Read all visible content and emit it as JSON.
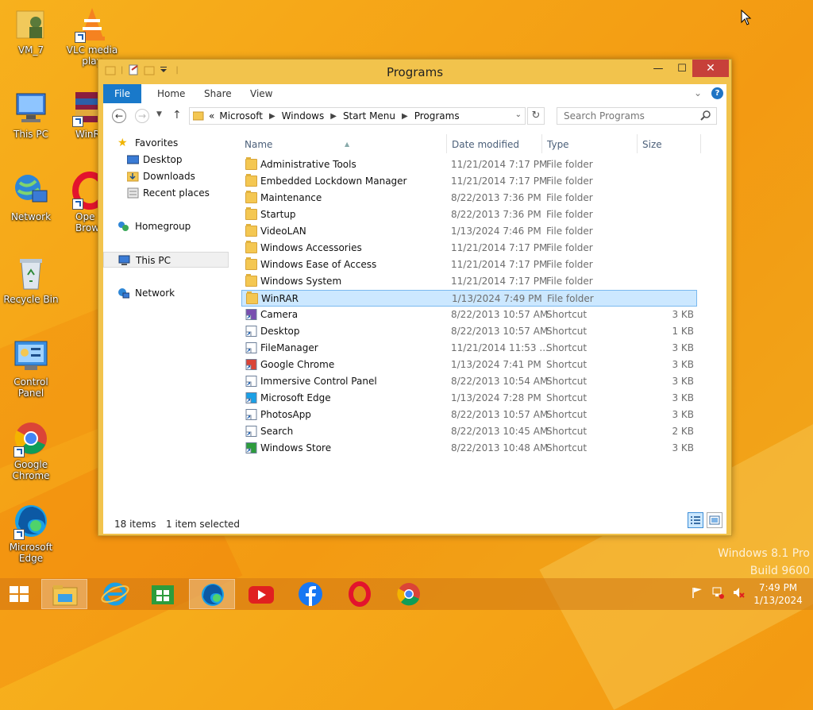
{
  "desktop": {
    "icons": [
      {
        "label": "VM_7"
      },
      {
        "label": "VLC media play"
      },
      {
        "label": "This PC"
      },
      {
        "label": "WinR"
      },
      {
        "label": "Network"
      },
      {
        "label": "Ope Brow"
      },
      {
        "label": "Recycle Bin"
      },
      {
        "label": "Control Panel"
      },
      {
        "label": "Google Chrome"
      },
      {
        "label": "Microsoft Edge"
      }
    ],
    "watermark": {
      "line1": "Windows 8.1 Pro",
      "line2": "Build 9600"
    }
  },
  "window": {
    "title": "Programs",
    "controls": {
      "minimize": "—",
      "maximize": "☐",
      "close": "✕"
    },
    "ribbon": {
      "tabs": [
        "File",
        "Home",
        "Share",
        "View"
      ],
      "help": "?"
    },
    "address": {
      "prefix": "«",
      "breadcrumbs": [
        "Microsoft",
        "Windows",
        "Start Menu",
        "Programs"
      ]
    },
    "search": {
      "placeholder": "Search Programs"
    },
    "nav_pane": {
      "favorites": "Favorites",
      "favorites_items": [
        "Desktop",
        "Downloads",
        "Recent places"
      ],
      "homegroup": "Homegroup",
      "this_pc": "This PC",
      "network": "Network"
    },
    "columns": {
      "name": "Name",
      "date": "Date modified",
      "type": "Type",
      "size": "Size"
    },
    "files": [
      {
        "name": "Administrative Tools",
        "date": "11/21/2014 7:17 PM",
        "type": "File folder",
        "size": "",
        "icon": "folder-icon"
      },
      {
        "name": "Embedded Lockdown Manager",
        "date": "11/21/2014 7:17 PM",
        "type": "File folder",
        "size": "",
        "icon": "folder-icon"
      },
      {
        "name": "Maintenance",
        "date": "8/22/2013 7:36 PM",
        "type": "File folder",
        "size": "",
        "icon": "folder-icon"
      },
      {
        "name": "Startup",
        "date": "8/22/2013 7:36 PM",
        "type": "File folder",
        "size": "",
        "icon": "folder-icon"
      },
      {
        "name": "VideoLAN",
        "date": "1/13/2024 7:46 PM",
        "type": "File folder",
        "size": "",
        "icon": "folder-icon"
      },
      {
        "name": "Windows Accessories",
        "date": "11/21/2014 7:17 PM",
        "type": "File folder",
        "size": "",
        "icon": "folder-icon"
      },
      {
        "name": "Windows Ease of Access",
        "date": "11/21/2014 7:17 PM",
        "type": "File folder",
        "size": "",
        "icon": "folder-icon"
      },
      {
        "name": "Windows System",
        "date": "11/21/2014 7:17 PM",
        "type": "File folder",
        "size": "",
        "icon": "folder-icon"
      },
      {
        "name": "WinRAR",
        "date": "1/13/2024 7:49 PM",
        "type": "File folder",
        "size": "",
        "icon": "folder-icon"
      },
      {
        "name": "Camera",
        "date": "8/22/2013 10:57 AM",
        "type": "Shortcut",
        "size": "3 KB",
        "icon": "camera-icon"
      },
      {
        "name": "Desktop",
        "date": "8/22/2013 10:57 AM",
        "type": "Shortcut",
        "size": "1 KB",
        "icon": "shortcut-icon"
      },
      {
        "name": "FileManager",
        "date": "11/21/2014 11:53 ...",
        "type": "Shortcut",
        "size": "3 KB",
        "icon": "shortcut-icon"
      },
      {
        "name": "Google Chrome",
        "date": "1/13/2024 7:41 PM",
        "type": "Shortcut",
        "size": "3 KB",
        "icon": "chrome-icon"
      },
      {
        "name": "Immersive Control Panel",
        "date": "8/22/2013 10:54 AM",
        "type": "Shortcut",
        "size": "3 KB",
        "icon": "shortcut-icon"
      },
      {
        "name": "Microsoft Edge",
        "date": "1/13/2024 7:28 PM",
        "type": "Shortcut",
        "size": "3 KB",
        "icon": "edge-icon"
      },
      {
        "name": "PhotosApp",
        "date": "8/22/2013 10:57 AM",
        "type": "Shortcut",
        "size": "3 KB",
        "icon": "shortcut-icon"
      },
      {
        "name": "Search",
        "date": "8/22/2013 10:45 AM",
        "type": "Shortcut",
        "size": "2 KB",
        "icon": "search-icon"
      },
      {
        "name": "Windows Store",
        "date": "8/22/2013 10:48 AM",
        "type": "Shortcut",
        "size": "3 KB",
        "icon": "store-icon"
      }
    ],
    "selected_name": "WinRAR",
    "status": {
      "items": "18 items",
      "selected": "1 item selected"
    }
  },
  "taskbar": {
    "apps": [
      "file-explorer-icon",
      "internet-explorer-icon",
      "store-icon",
      "edge-icon",
      "youtube-icon",
      "facebook-icon",
      "opera-icon",
      "chrome-icon"
    ],
    "active": "file-explorer-icon",
    "clock": {
      "time": "7:49 PM",
      "date": "1/13/2024"
    }
  },
  "colors": {
    "accent": "#1979ca",
    "selection": "#cce8ff",
    "window_frame": "#f2c34c",
    "close": "#c7403a"
  }
}
